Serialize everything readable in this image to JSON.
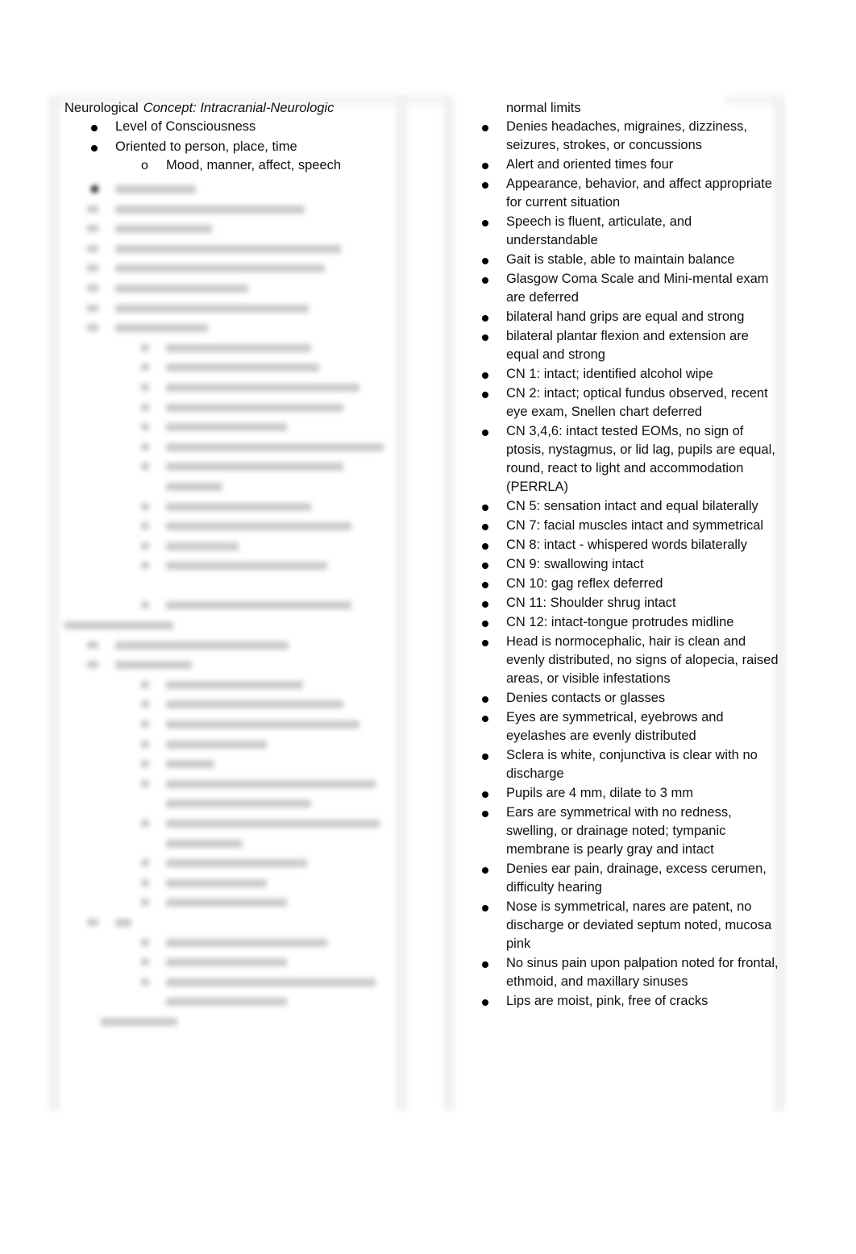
{
  "document": {
    "left_column": {
      "heading": "Neurological",
      "concept": "Concept: Intracranial-Neurologic",
      "items": [
        {
          "text": "Level of Consciousness"
        },
        {
          "text": "Oriented to person, place, time",
          "subitems": [
            "Mood, manner, affect, speech"
          ]
        }
      ],
      "sub_marker": "o",
      "blurred_note": "Remaining content is blurred"
    },
    "right_column": {
      "continuation": "normal limits",
      "items": [
        "Denies headaches, migraines, dizziness, seizures, strokes, or concussions",
        "Alert and oriented times four",
        "Appearance, behavior, and affect appropriate for current situation",
        "Speech is fluent, articulate, and understandable",
        "Gait is stable, able to maintain balance",
        "Glasgow Coma Scale and Mini-mental exam are deferred",
        "bilateral hand grips are equal and strong",
        "bilateral plantar flexion and extension are equal and strong",
        "CN 1: intact; identified alcohol wipe",
        "CN 2: intact; optical fundus observed, recent eye exam, Snellen chart deferred",
        "CN 3,4,6: intact tested EOMs, no sign of ptosis, nystagmus, or lid lag, pupils are equal, round, react to light and accommodation (PERRLA)",
        "CN 5: sensation intact and equal bilaterally",
        "CN 7: facial muscles intact and symmetrical",
        "CN 8: intact - whispered words bilaterally",
        "CN 9: swallowing intact",
        "CN 10: gag reflex deferred",
        "CN 11: Shoulder shrug intact",
        "CN 12: intact-tongue protrudes midline",
        "Head is normocephalic, hair is clean and evenly distributed, no signs of alopecia, raised areas, or visible infestations",
        "Denies contacts or glasses",
        "Eyes are symmetrical, eyebrows and eyelashes are evenly distributed",
        "Sclera is white, conjunctiva is clear with no discharge",
        "Pupils are 4 mm, dilate to 3 mm",
        "Ears are symmetrical with no redness, swelling, or drainage noted; tympanic membrane is pearly gray and intact",
        "Denies ear pain, drainage, excess cerumen, difficulty hearing",
        "Nose is symmetrical, nares are patent, no discharge or deviated septum noted, mucosa pink",
        "No sinus pain upon palpation noted for frontal, ethmoid, and maxillary sinuses",
        "Lips are moist, pink, free of cracks"
      ]
    }
  }
}
